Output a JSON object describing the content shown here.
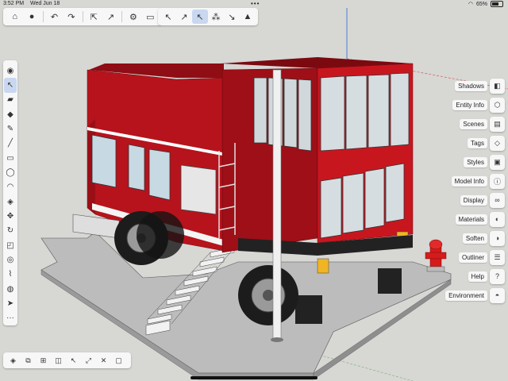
{
  "status_bar": {
    "time": "3:52 PM",
    "date": "Wed Jun 18",
    "dots": "•••",
    "battery_text": "65%",
    "battery_level": 0.65
  },
  "top_toolbar": {
    "buttons": [
      {
        "name": "home",
        "icon": "house-icon",
        "glyph": "⌂"
      },
      {
        "name": "account",
        "icon": "person-icon",
        "glyph": "●"
      },
      {
        "name": "undo",
        "icon": "undo-icon",
        "glyph": "↶"
      },
      {
        "name": "redo",
        "icon": "redo-icon",
        "glyph": "↷"
      },
      {
        "name": "export",
        "icon": "export-icon",
        "glyph": "⇱"
      },
      {
        "name": "share",
        "icon": "share-icon",
        "glyph": "↗"
      },
      {
        "name": "settings",
        "icon": "gear-icon",
        "glyph": "⚙"
      },
      {
        "name": "drive",
        "icon": "drive-icon",
        "glyph": "▭"
      }
    ]
  },
  "mode_toolbar": {
    "buttons": [
      {
        "name": "select-mode-1",
        "icon": "cursor-plus-icon",
        "glyph": "↖"
      },
      {
        "name": "select-mode-2",
        "icon": "cursor-line-icon",
        "glyph": "↗"
      },
      {
        "name": "select-mode-3",
        "icon": "cursor-active-icon",
        "glyph": "↖",
        "active": true
      },
      {
        "name": "select-mode-4",
        "icon": "cursor-group-icon",
        "glyph": "⁂"
      },
      {
        "name": "select-mode-5",
        "icon": "cursor-face-icon",
        "glyph": "↘"
      },
      {
        "name": "select-mode-6",
        "icon": "graduation-cap-icon",
        "glyph": "▲"
      }
    ]
  },
  "left_toolbar": {
    "buttons": [
      {
        "icon": "orbit-icon",
        "glyph": "◉"
      },
      {
        "icon": "select-arrow-icon",
        "glyph": "↖",
        "active": true
      },
      {
        "icon": "eraser-icon",
        "glyph": "▰"
      },
      {
        "icon": "paint-bucket-icon",
        "glyph": "◆"
      },
      {
        "icon": "pencil-icon",
        "glyph": "✎"
      },
      {
        "icon": "line-icon",
        "glyph": "╱"
      },
      {
        "icon": "rectangle-icon",
        "glyph": "▭"
      },
      {
        "icon": "circle-icon",
        "glyph": "◯"
      },
      {
        "icon": "arc-icon",
        "glyph": "◠"
      },
      {
        "icon": "push-pull-icon",
        "glyph": "◈"
      },
      {
        "icon": "move-icon",
        "glyph": "✥"
      },
      {
        "icon": "rotate-icon",
        "glyph": "↻"
      },
      {
        "icon": "scale-icon",
        "glyph": "◰"
      },
      {
        "icon": "offset-icon",
        "glyph": "◎"
      },
      {
        "icon": "tape-measure-icon",
        "glyph": "⌇"
      },
      {
        "icon": "section-plane-icon",
        "glyph": "◍"
      },
      {
        "icon": "pointer-icon",
        "glyph": "➤"
      },
      {
        "icon": "more-icon",
        "glyph": "···"
      }
    ]
  },
  "bottom_toolbar": {
    "buttons": [
      {
        "icon": "component-icon",
        "glyph": "◈"
      },
      {
        "icon": "group-icon",
        "glyph": "⧉"
      },
      {
        "icon": "boolean-icon",
        "glyph": "⊞"
      },
      {
        "icon": "solid-icon",
        "glyph": "◫"
      },
      {
        "icon": "select-similar-icon",
        "glyph": "↖"
      },
      {
        "icon": "scale-selection-icon",
        "glyph": "⤢"
      },
      {
        "icon": "cross-icon",
        "glyph": "✕"
      },
      {
        "icon": "box-icon",
        "glyph": "▢"
      }
    ]
  },
  "panels": [
    {
      "label": "Shadows",
      "icon": "shadows-icon",
      "glyph": "◧"
    },
    {
      "label": "Entity Info",
      "icon": "entity-info-icon",
      "glyph": "⬡"
    },
    {
      "label": "Scenes",
      "icon": "scenes-icon",
      "glyph": "▤"
    },
    {
      "label": "Tags",
      "icon": "tag-icon",
      "glyph": "◇"
    },
    {
      "label": "Styles",
      "icon": "styles-icon",
      "glyph": "▣"
    },
    {
      "label": "Model Info",
      "icon": "model-info-icon",
      "glyph": "ⓘ"
    },
    {
      "label": "Display",
      "icon": "glasses-icon",
      "glyph": "∞"
    },
    {
      "label": "Materials",
      "icon": "materials-icon",
      "glyph": "◐"
    },
    {
      "label": "Soften",
      "icon": "soften-icon",
      "glyph": "◑"
    },
    {
      "label": "Outliner",
      "icon": "outliner-icon",
      "glyph": "☰"
    },
    {
      "label": "Help",
      "icon": "help-icon",
      "glyph": "?"
    },
    {
      "label": "Environment",
      "icon": "environment-icon",
      "glyph": "◓"
    }
  ],
  "colors": {
    "truck_red": "#b5121b",
    "truck_dark_red": "#7a0a10",
    "truck_side_red": "#c4161f",
    "ground": "#b9b9b9",
    "chrome": "#e8e8e8",
    "accent": "#c9d7f0"
  }
}
